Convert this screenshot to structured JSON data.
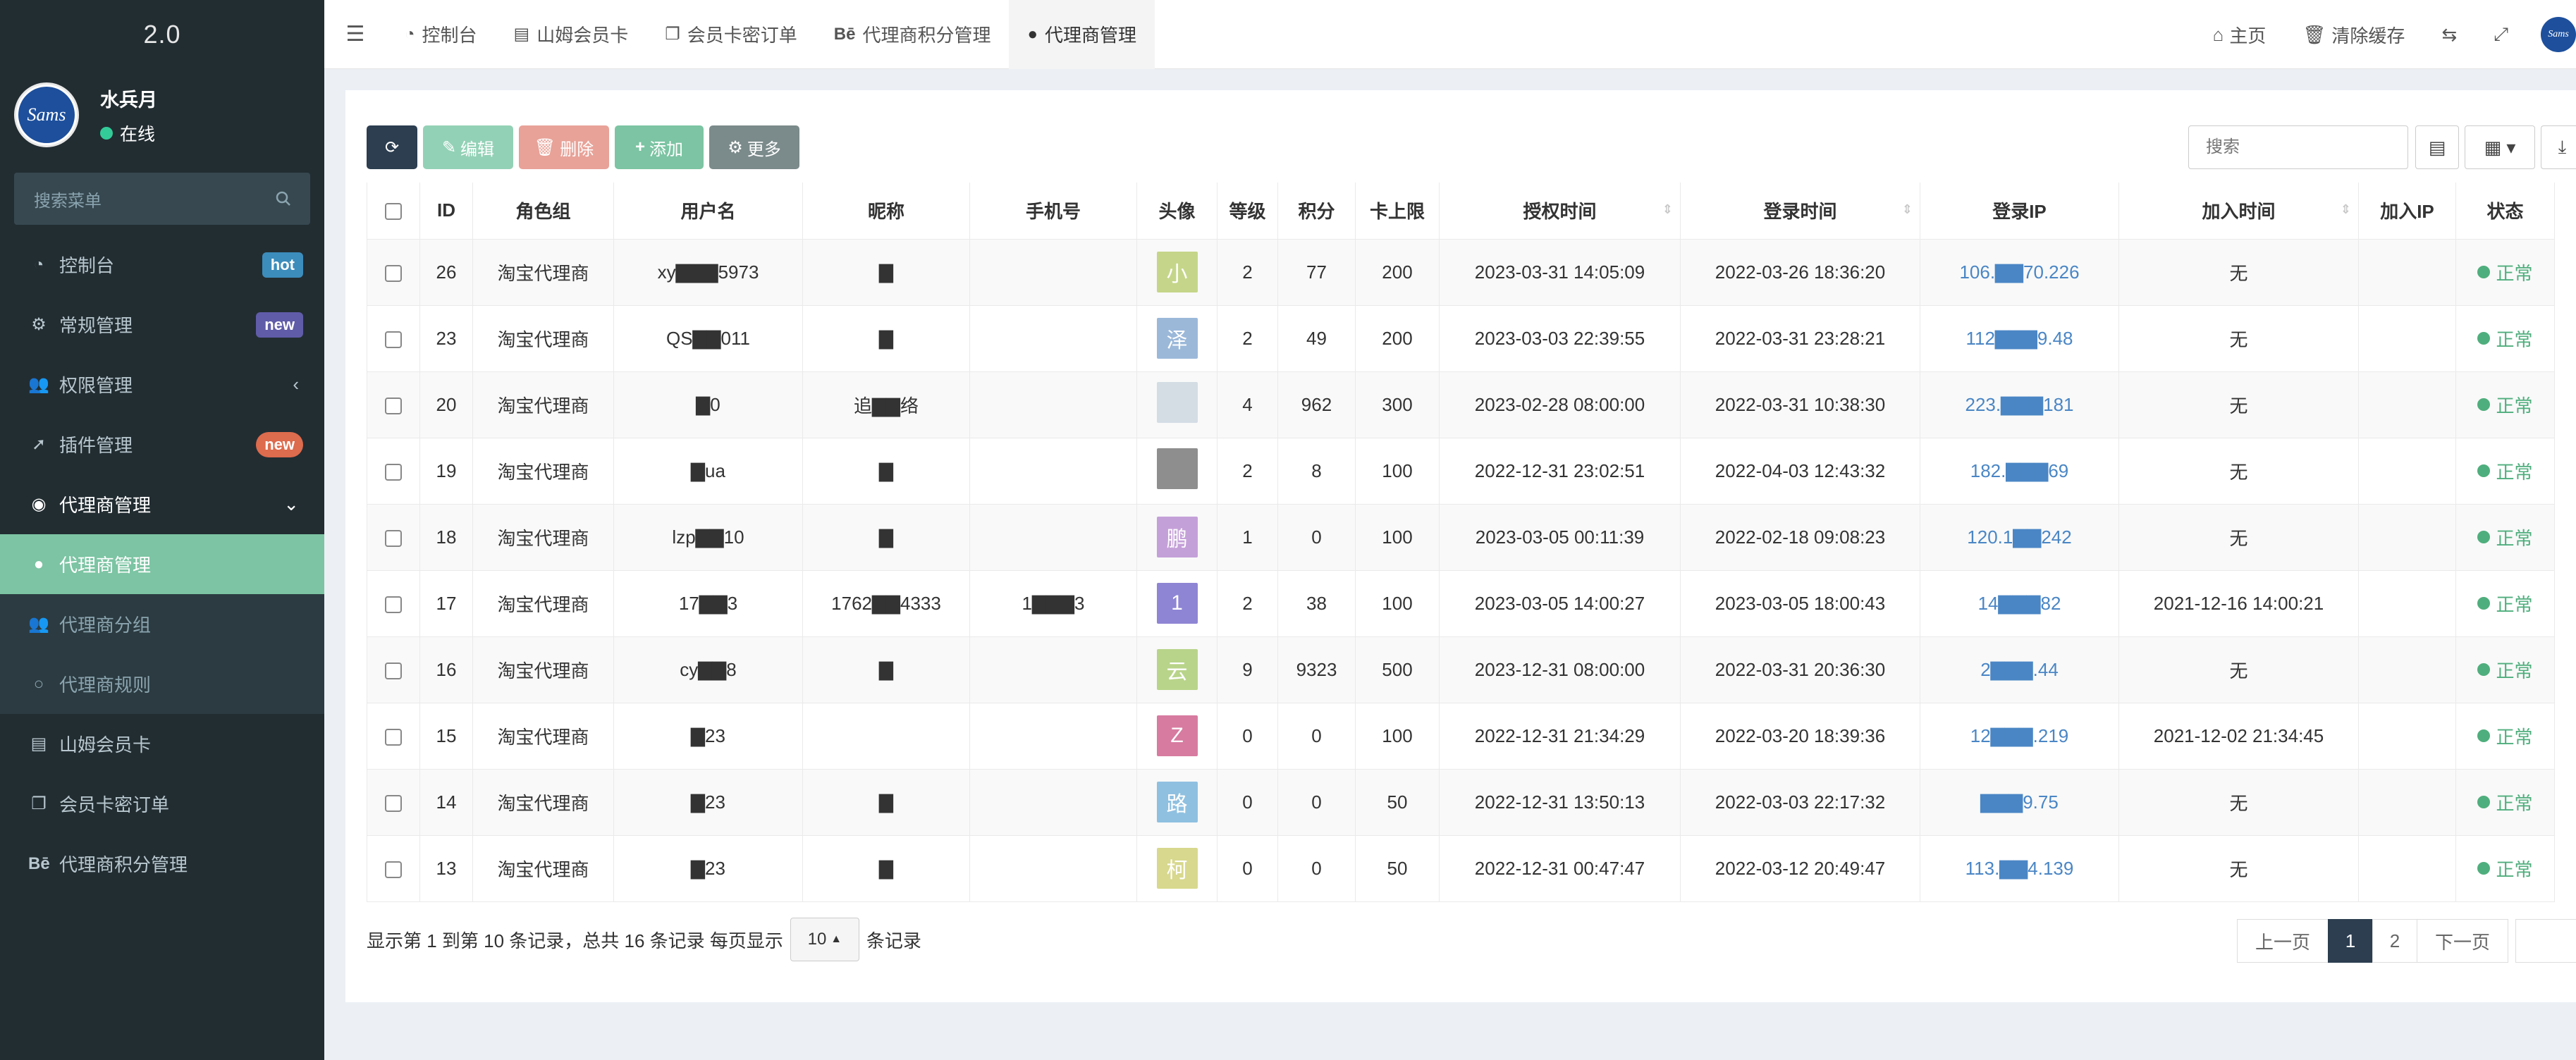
{
  "sidebar": {
    "brand": "2.0",
    "avatar_text": "Sams",
    "user_name": "水兵月",
    "status": "在线",
    "search_placeholder": "搜索菜单",
    "items": [
      {
        "label": "控制台",
        "icon": "dashboard-icon",
        "badge": "hot"
      },
      {
        "label": "常规管理",
        "icon": "cogs-icon",
        "badge": "new"
      },
      {
        "label": "权限管理",
        "icon": "users-icon",
        "chevron": "‹"
      },
      {
        "label": "插件管理",
        "icon": "rocket-icon",
        "badge": "new"
      },
      {
        "label": "代理商管理",
        "icon": "user-circle-icon",
        "chevron": "⌄"
      }
    ],
    "sub_items": [
      {
        "label": "代理商管理",
        "icon": "user-icon"
      },
      {
        "label": "代理商分组",
        "icon": "users-icon"
      },
      {
        "label": "代理商规则",
        "icon": "circle-icon"
      }
    ],
    "bottom_items": [
      {
        "label": "山姆会员卡",
        "icon": "id-card-icon"
      },
      {
        "label": "会员卡密订单",
        "icon": "clone-icon"
      },
      {
        "label": "代理商积分管理",
        "icon": "behance-icon"
      }
    ]
  },
  "topnav": {
    "tabs": [
      "控制台",
      "山姆会员卡",
      "会员卡密订单",
      "代理商积分管理",
      "代理商管理"
    ],
    "right": {
      "home": "主页",
      "clear_cache": "清除缓存",
      "logo": "Sams"
    }
  },
  "toolbar": {
    "edit": "编辑",
    "delete": "删除",
    "add": "添加",
    "more": "更多",
    "search_placeholder": "搜索"
  },
  "table": {
    "headers": [
      "ID",
      "角色组",
      "用户名",
      "昵称",
      "手机号",
      "头像",
      "等级",
      "积分",
      "卡上限",
      "授权时间",
      "登录时间",
      "登录IP",
      "加入时间",
      "加入IP",
      "状态"
    ],
    "rows": [
      {
        "id": "26",
        "group": "淘宝代理商",
        "username": "xy▇▇▇5973",
        "nickname": "▇",
        "phone": "",
        "avatar": "小",
        "avatar_color": "#c5d68a",
        "level": "2",
        "score": "77",
        "limit": "200",
        "auth_time": "2023-03-31 14:05:09",
        "login_time": "2022-03-26 18:36:20",
        "ip": "106.▇▇70.226",
        "join_time": "无",
        "status": "正常"
      },
      {
        "id": "23",
        "group": "淘宝代理商",
        "username": "QS▇▇011",
        "nickname": "▇",
        "phone": "",
        "avatar": "泽",
        "avatar_color": "#9bb8d9",
        "level": "2",
        "score": "49",
        "limit": "200",
        "auth_time": "2023-03-03 22:39:55",
        "login_time": "2022-03-31 23:28:21",
        "ip": "112▇▇▇9.48",
        "join_time": "无",
        "status": "正常"
      },
      {
        "id": "20",
        "group": "淘宝代理商",
        "username": "▇0",
        "nickname": "追▇▇络",
        "phone": "",
        "avatar": "",
        "avatar_color": "#d4dce4",
        "level": "4",
        "score": "962",
        "limit": "300",
        "auth_time": "2023-02-28 08:00:00",
        "login_time": "2022-03-31 10:38:30",
        "ip": "223.▇▇▇181",
        "join_time": "无",
        "status": "正常"
      },
      {
        "id": "19",
        "group": "淘宝代理商",
        "username": "▇ua",
        "nickname": "▇",
        "phone": "",
        "avatar": "",
        "avatar_color": "#8e8e8e",
        "level": "2",
        "score": "8",
        "limit": "100",
        "auth_time": "2022-12-31 23:02:51",
        "login_time": "2022-04-03 12:43:32",
        "ip": "182.▇▇▇69",
        "join_time": "无",
        "status": "正常"
      },
      {
        "id": "18",
        "group": "淘宝代理商",
        "username": "lzp▇▇10",
        "nickname": "▇",
        "phone": "",
        "avatar": "鹏",
        "avatar_color": "#c4a0d8",
        "level": "1",
        "score": "0",
        "limit": "100",
        "auth_time": "2023-03-05 00:11:39",
        "login_time": "2022-02-18 09:08:23",
        "ip": "120.1▇▇242",
        "join_time": "无",
        "status": "正常"
      },
      {
        "id": "17",
        "group": "淘宝代理商",
        "username": "17▇▇3",
        "nickname": "1762▇▇4333",
        "phone": "1▇▇▇3",
        "avatar": "1",
        "avatar_color": "#8e85d4",
        "level": "2",
        "score": "38",
        "limit": "100",
        "auth_time": "2023-03-05 14:00:27",
        "login_time": "2023-03-05 18:00:43",
        "ip": "14▇▇▇82",
        "join_time": "2021-12-16 14:00:21",
        "status": "正常"
      },
      {
        "id": "16",
        "group": "淘宝代理商",
        "username": "cy▇▇8",
        "nickname": "▇",
        "phone": "",
        "avatar": "云",
        "avatar_color": "#b8d48a",
        "level": "9",
        "score": "9323",
        "limit": "500",
        "auth_time": "2023-12-31 08:00:00",
        "login_time": "2022-03-31 20:36:30",
        "ip": "2▇▇▇.44",
        "join_time": "无",
        "status": "正常"
      },
      {
        "id": "15",
        "group": "淘宝代理商",
        "username": "▇23",
        "nickname": "",
        "phone": "",
        "avatar": "Z",
        "avatar_color": "#d77ba0",
        "level": "0",
        "score": "0",
        "limit": "100",
        "auth_time": "2022-12-31 21:34:29",
        "login_time": "2022-03-20 18:39:36",
        "ip": "12▇▇▇.219",
        "join_time": "2021-12-02 21:34:45",
        "status": "正常"
      },
      {
        "id": "14",
        "group": "淘宝代理商",
        "username": "▇23",
        "nickname": "▇",
        "phone": "",
        "avatar": "路",
        "avatar_color": "#8fc0e0",
        "level": "0",
        "score": "0",
        "limit": "50",
        "auth_time": "2022-12-31 13:50:13",
        "login_time": "2022-03-03 22:17:32",
        "ip": "▇▇▇9.75",
        "join_time": "无",
        "status": "正常"
      },
      {
        "id": "13",
        "group": "淘宝代理商",
        "username": "▇23",
        "nickname": "▇",
        "phone": "",
        "avatar": "柯",
        "avatar_color": "#d8d88e",
        "level": "0",
        "score": "0",
        "limit": "50",
        "auth_time": "2022-12-31 00:47:47",
        "login_time": "2022-03-12 20:49:47",
        "ip": "113.▇▇4.139",
        "join_time": "无",
        "status": "正常"
      }
    ]
  },
  "footer": {
    "summary": "显示第 1 到第 10 条记录，总共 16 条记录 每页显示",
    "page_size": "10",
    "suffix": "条记录",
    "prev": "上一页",
    "pages": [
      "1",
      "2"
    ],
    "next": "下一页"
  }
}
